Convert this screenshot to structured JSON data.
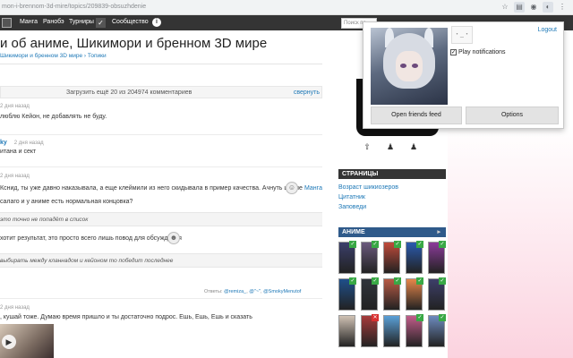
{
  "browser": {
    "url_main": "mon-i-brennom-3d-mire/topics/209839-obsuzhdenie",
    "icons": [
      "star-icon",
      "extension-icon-1",
      "extension-icon-2",
      "menu-icon"
    ]
  },
  "nav": {
    "items": [
      "Манга",
      "Ранобэ",
      "Турниры",
      "Сообщество"
    ],
    "search_placeholder": "Поиск по"
  },
  "page": {
    "title": "и об аниме, Шикимори и бренном 3D мире",
    "breadcrumb": "Шикимори и бренном 3D мире  ›  Топики"
  },
  "loadbar": {
    "text": "Загрузить ещё 20 из 204974 комментариев",
    "collapse": "свернуть"
  },
  "comments": [
    {
      "meta": "2 дня назад",
      "text": "люблю Кейон, не добавлять не буду."
    },
    {
      "author": "ky",
      "meta": "2 дня назад",
      "text": "итана и сект"
    },
    {
      "meta": "2 дня назад",
      "text": "Кснид, ты уже давно наказывала, а еще клеймили из него скидывала в пример качества. Ачнуть штоле",
      "text2": "салаго и у аниме есть нормальная концовка?",
      "manga_label": "Манга"
    },
    {
      "quote": "это точно не попадёт в список"
    },
    {
      "text": "хотит результат, это просто всего лишь повод для обсуждения"
    },
    {
      "quote": "выбирать между кланнадом и кейоном то победит последнее"
    },
    {
      "meta": "2 дня назад",
      "text": ", кушай тоже. Думаю время пришло и ты достаточно подрос. Ешь, Ешь, Ешь и сказать"
    }
  ],
  "replies": {
    "label": "Ответы:",
    "users": [
      "@remiza_",
      "@\"~\"",
      "@SmokyMenutof"
    ]
  },
  "sidebar": {
    "pages_header": "СТРАНИЦЫ",
    "pages_links": [
      "Возраст шикиозеров",
      "Цитатник",
      "Заповеди"
    ],
    "anime_header": "АНИМЕ",
    "anime_posters": [
      {
        "color": "#3b3f6b",
        "badge": "check"
      },
      {
        "color": "#6b5a7d",
        "badge": "check"
      },
      {
        "color": "#c14b3b",
        "badge": "check"
      },
      {
        "color": "#2a5bb0",
        "badge": "check"
      },
      {
        "color": "#8c3b9a",
        "badge": "check"
      },
      {
        "color": "#1f4f8a",
        "badge": "check"
      },
      {
        "color": "#30343b",
        "badge": "check"
      },
      {
        "color": "#b85a45",
        "badge": "check"
      },
      {
        "color": "#e6864a",
        "badge": "check"
      },
      {
        "color": "#3d3f69",
        "badge": "check"
      },
      {
        "color": "#d0c2b4",
        "badge": "none"
      },
      {
        "color": "#a63b3b",
        "badge": "x"
      },
      {
        "color": "#5aa0d8",
        "badge": "none"
      },
      {
        "color": "#c25d8a",
        "badge": "check"
      },
      {
        "color": "#6d8bbf",
        "badge": "check"
      }
    ]
  },
  "popup": {
    "logout": "Logout",
    "play_notifications": "Play notifications",
    "play_checked": true,
    "open_friends_feed": "Open friends feed",
    "options": "Options",
    "icon_text": "・_・"
  },
  "colors": {
    "nav_bg": "#343434",
    "link": "#1d78b7",
    "check_badge": "#39a845",
    "x_badge": "#d83131"
  }
}
